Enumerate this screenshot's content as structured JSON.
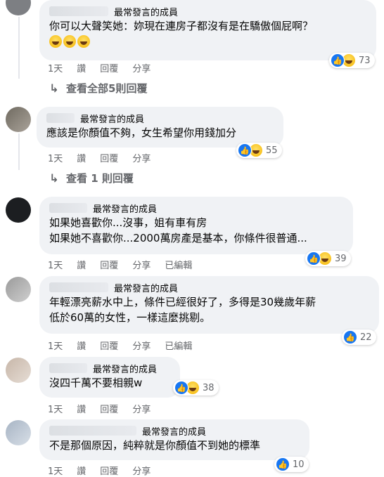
{
  "icons": {
    "like": "thumbs-up-icon",
    "haha": "laughing-face-icon",
    "reply_arrow": "reply-arrow-icon"
  },
  "colors": {
    "bubble": "#f0f2f5",
    "meta_text": "#65676b",
    "like_blue": "#1877f2",
    "haha_yellow": "#f5b400"
  },
  "comments": [
    {
      "badge": "最常發言的成員",
      "lines": [
        "你可以大聲笑她：妳現在連房子都沒有是在驕傲個屁啊？"
      ],
      "emoji_count": 3,
      "time": "1天",
      "like": "讚",
      "reply": "回覆",
      "share": "分享",
      "edited": "",
      "reaction_count": "73",
      "replies_link": "查看全部5則回覆"
    },
    {
      "badge": "最常發言的成員",
      "lines": [
        "應該是你顏值不夠，女生希望你用錢加分"
      ],
      "time": "1天",
      "like": "讚",
      "reply": "回覆",
      "share": "分享",
      "edited": "",
      "reaction_count": "55",
      "replies_link": "查看 1 則回覆"
    },
    {
      "badge": "最常發言的成員",
      "lines": [
        "如果她喜歡你...沒事，姐有車有房",
        "如果她不喜歡你...2000萬房產是基本，你條件很普通..."
      ],
      "time": "1天",
      "like": "讚",
      "reply": "回覆",
      "share": "分享",
      "edited": "已編輯",
      "reaction_count": "39"
    },
    {
      "badge": "最常發言的成員",
      "lines": [
        "年輕漂亮薪水中上，條件已經很好了，多得是30幾歲年薪",
        "低於60萬的女性，一樣這麼挑剔。"
      ],
      "time": "1天",
      "like": "讚",
      "reply": "回覆",
      "share": "分享",
      "edited": "已編輯",
      "reaction_count": "22"
    },
    {
      "badge": "最常發言的成員",
      "lines": [
        "沒四千萬不要相親w"
      ],
      "time": "1天",
      "like": "讚",
      "reply": "回覆",
      "share": "分享",
      "edited": "",
      "reaction_count": "38"
    },
    {
      "badge": "最常發言的成員",
      "lines": [
        "不是那個原因，純粹就是你顏值不到她的標準"
      ],
      "time": "1天",
      "like": "讚",
      "reply": "回覆",
      "share": "分享",
      "edited": "",
      "reaction_count": "10"
    }
  ]
}
